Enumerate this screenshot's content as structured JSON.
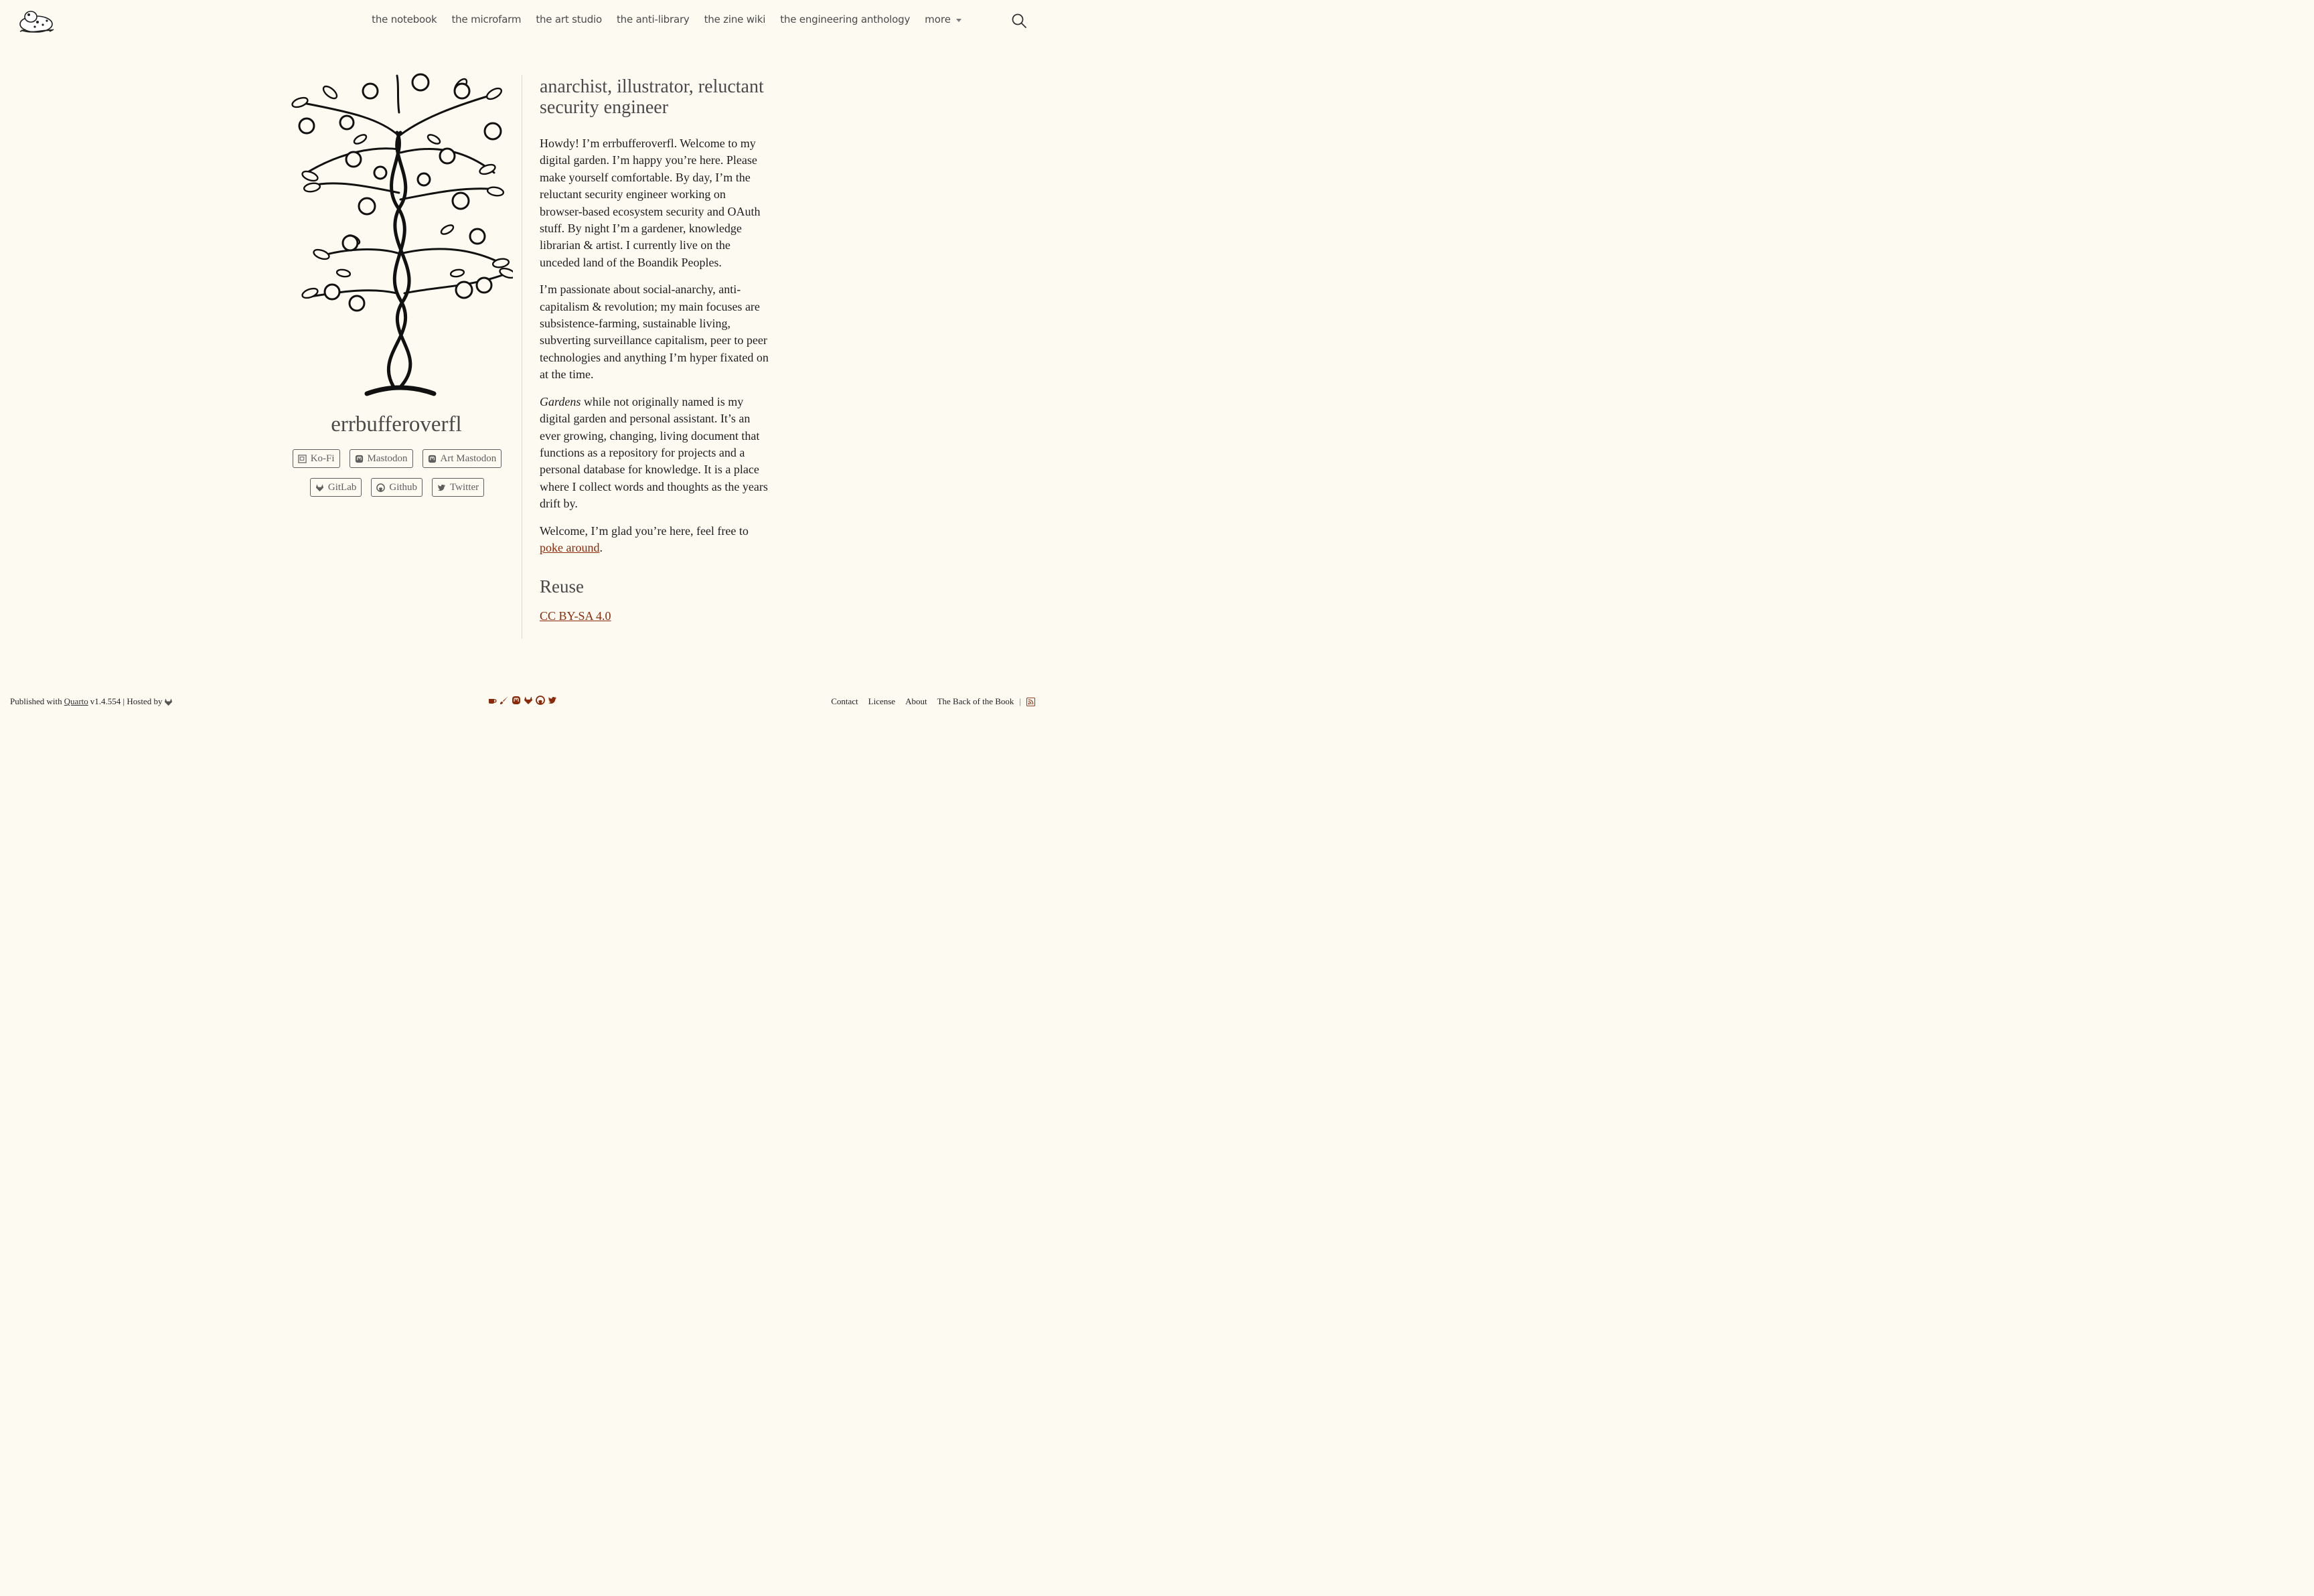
{
  "nav": {
    "links": [
      "the notebook",
      "the microfarm",
      "the art studio",
      "the anti-library",
      "the zine wiki",
      "the engineering anthology"
    ],
    "more_label": "more",
    "logo_icon": "toad-logo-icon",
    "search_icon": "search-icon"
  },
  "profile": {
    "name": "errbufferoverfl",
    "buttons_row1": [
      {
        "label": "Ko-Fi",
        "icon": "kofi-icon"
      },
      {
        "label": "Mastodon",
        "icon": "mastodon-icon"
      },
      {
        "label": "Art Mastodon",
        "icon": "mastodon-icon"
      }
    ],
    "buttons_row2": [
      {
        "label": "GitLab",
        "icon": "gitlab-icon"
      },
      {
        "label": "Github",
        "icon": "github-icon"
      },
      {
        "label": "Twitter",
        "icon": "twitter-icon"
      }
    ]
  },
  "content": {
    "tagline": "anarchist, illustrator, reluctant security engineer",
    "para1": "Howdy! I’m errbufferoverfl. Welcome to my digital garden. I’m happy you’re here. Please make yourself comfortable. By day, I’m the reluctant security engineer working on browser-based ecosystem security and OAuth stuff. By night I’m a gardener, knowledge librarian & artist. I currently live on the unceded land of the Boandik Peoples.",
    "para2": "I’m passionate about social-anarchy, anti-capitalism & revolution; my main focuses are subsistence-farming, sustainable living, subverting surveillance capitalism, peer to peer technologies and anything I’m hyper fixated on at the time.",
    "para3_em": "Gardens",
    "para3_rest": " while not originally named is my digital garden and personal assistant. It’s an ever growing, changing, living document that functions as a repository for projects and a personal database for knowledge. It is a place where I collect words and thoughts as the years drift by.",
    "para4_text": "Welcome, I’m glad you’re here, feel free to ",
    "para4_link": "poke around",
    "para4_end": ".",
    "reuse_heading": "Reuse",
    "reuse_link": "CC BY-SA 4.0"
  },
  "footer": {
    "published_prefix": "Published with",
    "quarto_link": "Quarto",
    "version": "v1.4.554 | Hosted by",
    "center_icons": [
      "coffee-icon",
      "brush-icon",
      "mastodon-icon",
      "gitlab-icon",
      "github-icon",
      "twitter-icon"
    ],
    "links": [
      "Contact",
      "License",
      "About",
      "The Back of the Book"
    ],
    "sep": "|",
    "rss_icon": "rss-icon"
  },
  "colors": {
    "background": "#fdfaf1",
    "accent": "#8a2a0a",
    "text": "#1d1d1d",
    "muted": "#4a4a4a"
  }
}
